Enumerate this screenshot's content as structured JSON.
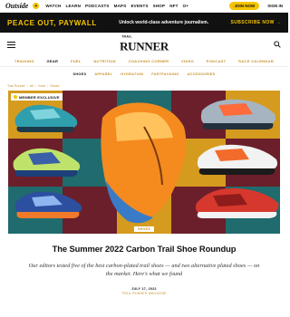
{
  "outside_bar": {
    "logo": "Outside",
    "plus": "+",
    "nav": [
      "WATCH",
      "LEARN",
      "PODCASTS",
      "MAPS",
      "EVENTS",
      "SHOP",
      "NFT",
      "O+"
    ],
    "join_label": "JOIN NOW",
    "signin_label": "SIGN IN"
  },
  "promo": {
    "left": "PEACE OUT, PAYWALL",
    "middle": "Unlock world-class adventure journalism.",
    "right": "SUBSCRIBE NOW"
  },
  "brand": {
    "small": "TRAIL",
    "big": "RUNNER"
  },
  "categories": [
    {
      "label": "TRAINING",
      "active": false
    },
    {
      "label": "GEAR",
      "active": true
    },
    {
      "label": "FUEL",
      "active": false
    },
    {
      "label": "NUTRITION",
      "active": false
    },
    {
      "label": "COACHING CORNER",
      "active": false
    },
    {
      "label": "VIDEO",
      "active": false
    },
    {
      "label": "PODCAST",
      "active": false
    },
    {
      "label": "RACE CALENDAR",
      "active": false
    }
  ],
  "subnav": [
    {
      "label": "SHOES",
      "active": true
    },
    {
      "label": "APPAREL",
      "active": false
    },
    {
      "label": "HYDRATION",
      "active": false
    },
    {
      "label": "FASTPACKING",
      "active": false
    },
    {
      "label": "ACCESSORIES",
      "active": false
    }
  ],
  "breadcrumbs": [
    "Trail Runner",
    "All",
    "Gear",
    "Shoes"
  ],
  "hero": {
    "badge": "MEMBER EXCLUSIVE",
    "tag": "SHOES"
  },
  "article": {
    "title": "The Summer 2022 Carbon Trail Shoe Roundup",
    "dek": "Our editors tested five of the best carbon-plated trail shoes — and two alternative plated shoes — on the market. Here's what we found",
    "date": "JULY 27, 2022",
    "author": "TRAIL RUNNER MAGAZINE"
  },
  "colors": {
    "accent_yellow": "#f5c400",
    "link_gold": "#c6922b",
    "hero_maroon": "#6b1f2a",
    "hero_teal": "#1f6b6e",
    "hero_mustard": "#d59b1e"
  }
}
